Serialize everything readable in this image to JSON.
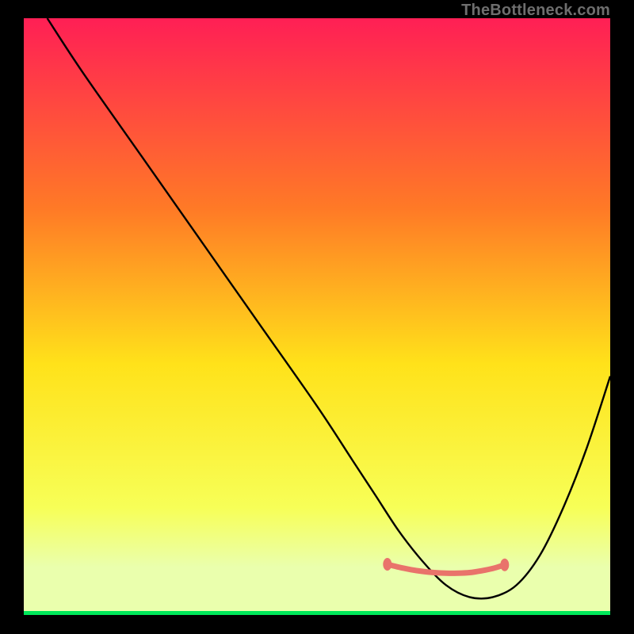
{
  "watermark": "TheBottleneck.com",
  "chart_data": {
    "type": "line",
    "title": "",
    "xlabel": "",
    "ylabel": "",
    "xlim": [
      0,
      100
    ],
    "ylim": [
      0,
      100
    ],
    "gradient_colors": {
      "top": "#ff1f55",
      "upper_mid": "#ff7a26",
      "mid": "#ffe21a",
      "lower_mid": "#f7ff57",
      "bottom_line": "#00e85a"
    },
    "series": [
      {
        "name": "bottleneck-curve",
        "x": [
          4,
          10,
          20,
          30,
          40,
          50,
          56,
          60,
          64,
          68,
          72,
          76,
          80,
          84,
          88,
          92,
          96,
          100
        ],
        "y": [
          100,
          91,
          77,
          63,
          49,
          35,
          26,
          20,
          14,
          9,
          5,
          3,
          3,
          5,
          10,
          18,
          28,
          40
        ]
      },
      {
        "name": "highlight-band",
        "x": [
          62,
          64,
          66,
          68,
          70,
          72,
          74,
          76,
          78,
          80,
          82
        ],
        "y": [
          8.5,
          8.0,
          7.6,
          7.3,
          7.1,
          7.0,
          7.0,
          7.1,
          7.4,
          7.8,
          8.4
        ]
      }
    ],
    "highlight_color": "#e9736b",
    "annotations": []
  }
}
